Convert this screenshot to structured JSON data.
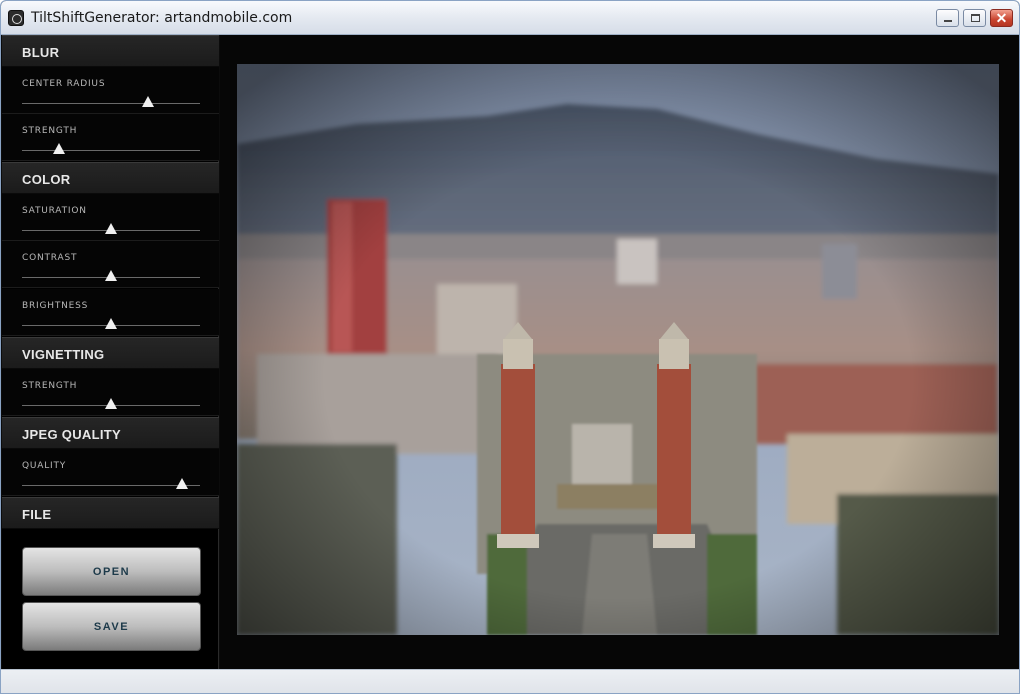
{
  "window": {
    "title": "TiltShiftGenerator: artandmobile.com",
    "close_glyph": "✕"
  },
  "sidebar": {
    "blur": {
      "header": "BLUR",
      "center_radius": {
        "label": "CENTER RADIUS",
        "value": 0.71
      },
      "strength": {
        "label": "STRENGTH",
        "value": 0.21
      }
    },
    "color": {
      "header": "COLOR",
      "saturation": {
        "label": "SATURATION",
        "value": 0.5
      },
      "contrast": {
        "label": "CONTRAST",
        "value": 0.5
      },
      "brightness": {
        "label": "BRIGHTNESS",
        "value": 0.5
      }
    },
    "vignetting": {
      "header": "VIGNETTING",
      "strength": {
        "label": "STRENGTH",
        "value": 0.5
      }
    },
    "jpeg_quality": {
      "header": "JPEG QUALITY",
      "quality": {
        "label": "QUALITY",
        "value": 0.9
      }
    },
    "file": {
      "header": "FILE",
      "open_label": "OPEN",
      "save_label": "SAVE"
    }
  },
  "photo": {
    "subject": "tilt-shift city photo"
  }
}
